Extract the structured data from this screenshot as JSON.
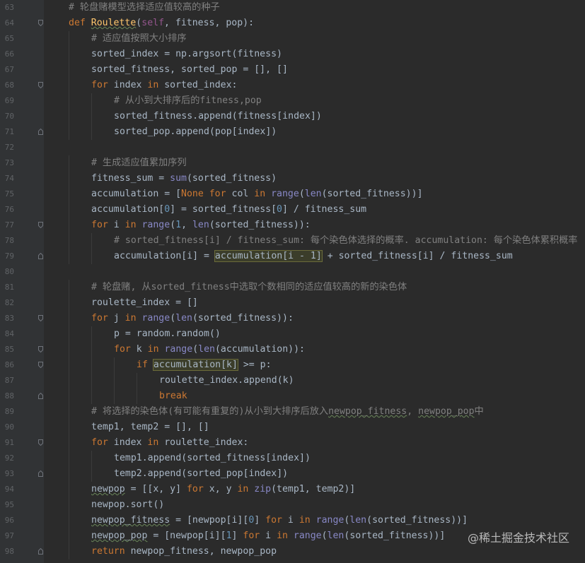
{
  "lines": [
    {
      "n": "63",
      "indent": 0,
      "fold": "",
      "tokens": [
        [
          "cm",
          "# 轮盘赌模型选择适应值较高的种子"
        ]
      ]
    },
    {
      "n": "64",
      "indent": 0,
      "fold": "open",
      "tokens": [
        [
          "kw",
          "def "
        ],
        [
          "fn wavy",
          "Roulette"
        ],
        [
          "",
          "("
        ],
        [
          "self",
          "self"
        ],
        [
          "",
          ", fitness, pop):"
        ]
      ]
    },
    {
      "n": "65",
      "indent": 1,
      "fold": "",
      "tokens": [
        [
          "cm",
          "# 适应值按照大小排序"
        ]
      ]
    },
    {
      "n": "66",
      "indent": 1,
      "fold": "",
      "tokens": [
        [
          "",
          "sorted_index = np.argsort(fitness)"
        ]
      ]
    },
    {
      "n": "67",
      "indent": 1,
      "fold": "",
      "tokens": [
        [
          "",
          "sorted_fitness, sorted_pop = [], []"
        ]
      ]
    },
    {
      "n": "68",
      "indent": 1,
      "fold": "open",
      "tokens": [
        [
          "kw",
          "for "
        ],
        [
          "",
          "index "
        ],
        [
          "kw",
          "in "
        ],
        [
          "",
          "sorted_index:"
        ]
      ]
    },
    {
      "n": "69",
      "indent": 2,
      "fold": "",
      "tokens": [
        [
          "cm",
          "# 从小到大排序后的fitness,pop"
        ]
      ]
    },
    {
      "n": "70",
      "indent": 2,
      "fold": "",
      "tokens": [
        [
          "",
          "sorted_fitness.append(fitness[index])"
        ]
      ]
    },
    {
      "n": "71",
      "indent": 2,
      "fold": "end",
      "tokens": [
        [
          "",
          "sorted_pop.append(pop[index])"
        ]
      ]
    },
    {
      "n": "72",
      "indent": 0,
      "fold": "",
      "tokens": []
    },
    {
      "n": "73",
      "indent": 1,
      "fold": "",
      "tokens": [
        [
          "cm",
          "# 生成适应值累加序列"
        ]
      ]
    },
    {
      "n": "74",
      "indent": 1,
      "fold": "",
      "tokens": [
        [
          "",
          "fitness_sum = "
        ],
        [
          "bi",
          "sum"
        ],
        [
          "",
          "(sorted_fitness)"
        ]
      ]
    },
    {
      "n": "75",
      "indent": 1,
      "fold": "",
      "tokens": [
        [
          "",
          "accumulation = ["
        ],
        [
          "kw",
          "None for "
        ],
        [
          "",
          "col "
        ],
        [
          "kw",
          "in "
        ],
        [
          "bi",
          "range"
        ],
        [
          "",
          "("
        ],
        [
          "bi",
          "len"
        ],
        [
          "",
          "(sorted_fitness))]"
        ]
      ]
    },
    {
      "n": "76",
      "indent": 1,
      "fold": "",
      "tokens": [
        [
          "",
          "accumulation["
        ],
        [
          "num",
          "0"
        ],
        [
          "",
          "] = sorted_fitness["
        ],
        [
          "num",
          "0"
        ],
        [
          "",
          "] / fitness_sum"
        ]
      ]
    },
    {
      "n": "77",
      "indent": 1,
      "fold": "open",
      "tokens": [
        [
          "kw",
          "for "
        ],
        [
          "",
          "i "
        ],
        [
          "kw",
          "in "
        ],
        [
          "bi",
          "range"
        ],
        [
          "",
          "("
        ],
        [
          "num",
          "1"
        ],
        [
          "",
          ", "
        ],
        [
          "bi",
          "len"
        ],
        [
          "",
          "(sorted_fitness)):"
        ]
      ]
    },
    {
      "n": "78",
      "indent": 2,
      "fold": "",
      "tokens": [
        [
          "cm",
          "# sorted_fitness[i] / fitness_sum: 每个染色体选择的概率. accumulation: 每个染色体累积概率"
        ]
      ]
    },
    {
      "n": "79",
      "indent": 2,
      "fold": "end",
      "tokens": [
        [
          "",
          "accumulation[i] = "
        ],
        [
          "hl",
          "accumulation[i - 1]"
        ],
        [
          "",
          " + sorted_fitness[i] / fitness_sum"
        ]
      ]
    },
    {
      "n": "80",
      "indent": 0,
      "fold": "",
      "tokens": []
    },
    {
      "n": "81",
      "indent": 1,
      "fold": "",
      "tokens": [
        [
          "cm",
          "# 轮盘赌, 从sorted_fitness中选取个数相同的适应值较高的新的染色体"
        ]
      ]
    },
    {
      "n": "82",
      "indent": 1,
      "fold": "",
      "tokens": [
        [
          "",
          "roulette_index = []"
        ]
      ]
    },
    {
      "n": "83",
      "indent": 1,
      "fold": "open",
      "tokens": [
        [
          "kw",
          "for "
        ],
        [
          "",
          "j "
        ],
        [
          "kw",
          "in "
        ],
        [
          "bi",
          "range"
        ],
        [
          "",
          "("
        ],
        [
          "bi",
          "len"
        ],
        [
          "",
          "(sorted_fitness)):"
        ]
      ]
    },
    {
      "n": "84",
      "indent": 2,
      "fold": "",
      "tokens": [
        [
          "",
          "p = random.random()"
        ]
      ]
    },
    {
      "n": "85",
      "indent": 2,
      "fold": "open",
      "tokens": [
        [
          "kw",
          "for "
        ],
        [
          "",
          "k "
        ],
        [
          "kw",
          "in "
        ],
        [
          "bi",
          "range"
        ],
        [
          "",
          "("
        ],
        [
          "bi",
          "len"
        ],
        [
          "",
          "(accumulation)):"
        ]
      ]
    },
    {
      "n": "86",
      "indent": 3,
      "fold": "open",
      "tokens": [
        [
          "kw",
          "if "
        ],
        [
          "hl",
          "accumulation[k]"
        ],
        [
          "",
          " >= p:"
        ]
      ]
    },
    {
      "n": "87",
      "indent": 4,
      "fold": "",
      "tokens": [
        [
          "",
          "roulette_index.append(k)"
        ]
      ]
    },
    {
      "n": "88",
      "indent": 4,
      "fold": "end",
      "tokens": [
        [
          "kw",
          "break"
        ]
      ]
    },
    {
      "n": "89",
      "indent": 1,
      "fold": "",
      "tokens": [
        [
          "cm",
          "# 将选择的染色体(有可能有重复的)从小到大排序后放入"
        ],
        [
          "cm wavy",
          "newpop_fitness"
        ],
        [
          "cm",
          ", "
        ],
        [
          "cm wavy",
          "newpop_pop"
        ],
        [
          "cm",
          "中"
        ]
      ]
    },
    {
      "n": "90",
      "indent": 1,
      "fold": "",
      "tokens": [
        [
          "",
          "temp1, temp2 = [], []"
        ]
      ]
    },
    {
      "n": "91",
      "indent": 1,
      "fold": "open",
      "tokens": [
        [
          "kw",
          "for "
        ],
        [
          "",
          "index "
        ],
        [
          "kw",
          "in "
        ],
        [
          "",
          "roulette_index:"
        ]
      ]
    },
    {
      "n": "92",
      "indent": 2,
      "fold": "",
      "tokens": [
        [
          "",
          "temp1.append(sorted_fitness[index])"
        ]
      ]
    },
    {
      "n": "93",
      "indent": 2,
      "fold": "end",
      "tokens": [
        [
          "",
          "temp2.append(sorted_pop[index])"
        ]
      ]
    },
    {
      "n": "94",
      "indent": 1,
      "fold": "",
      "tokens": [
        [
          "wavy",
          "newpop"
        ],
        [
          "",
          " = [[x, y] "
        ],
        [
          "kw",
          "for "
        ],
        [
          "",
          "x, y "
        ],
        [
          "kw",
          "in "
        ],
        [
          "bi",
          "zip"
        ],
        [
          "",
          "(temp1, temp2)]"
        ]
      ]
    },
    {
      "n": "95",
      "indent": 1,
      "fold": "",
      "tokens": [
        [
          "",
          "newpop.sort()"
        ]
      ]
    },
    {
      "n": "96",
      "indent": 1,
      "fold": "",
      "tokens": [
        [
          "wavy",
          "newpop_fitness"
        ],
        [
          "",
          " = [newpop[i]["
        ],
        [
          "num",
          "0"
        ],
        [
          "",
          "] "
        ],
        [
          "kw",
          "for "
        ],
        [
          "",
          "i "
        ],
        [
          "kw",
          "in "
        ],
        [
          "bi",
          "range"
        ],
        [
          "",
          "("
        ],
        [
          "bi",
          "len"
        ],
        [
          "",
          "(sorted_fitness))]"
        ]
      ]
    },
    {
      "n": "97",
      "indent": 1,
      "fold": "",
      "tokens": [
        [
          "wavy",
          "newpop_pop"
        ],
        [
          "",
          " = [newpop[i]["
        ],
        [
          "num",
          "1"
        ],
        [
          "",
          "] "
        ],
        [
          "kw",
          "for "
        ],
        [
          "",
          "i "
        ],
        [
          "kw",
          "in "
        ],
        [
          "bi",
          "range"
        ],
        [
          "",
          "("
        ],
        [
          "bi",
          "len"
        ],
        [
          "",
          "(sorted_fitness))]"
        ]
      ]
    },
    {
      "n": "98",
      "indent": 1,
      "fold": "end",
      "tokens": [
        [
          "kw",
          "return "
        ],
        [
          "",
          "newpop_fitness, newpop_pop"
        ]
      ]
    }
  ],
  "watermark": "@稀土掘金技术社区"
}
